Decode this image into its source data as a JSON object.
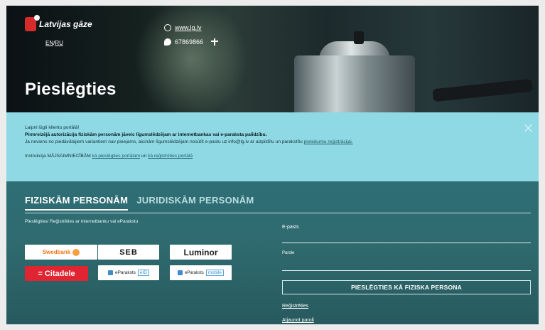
{
  "header": {
    "brand": "Latvijas gāze",
    "lang_en": "EN",
    "lang_sep": "/",
    "lang_ru": "RU",
    "website": "www.lg.lv",
    "phone": "67869866",
    "page_title": "Pieslēgties"
  },
  "notice": {
    "line1": "Laipni lūgti klientu portālā!",
    "line2": "Pirmreizējā autorizācija fiziskām personām jāveic līgumslēdzējam ar internetbankas vai e-paraksta palīdzību.",
    "line3_text": "Ja neviens no piedāvātajiem variantiem nav pieejams, aicinām līgumslēdzējam nosūtīt e-pastu uz info@lg.lv ar aizpildītu un parakstītu",
    "line3_link": "pieteikumu reģistrācijai.",
    "line4_text": "Instrukcija MĀJSAIMNIECĪBĀM",
    "line4_link1": "kā pieslēgties portālam",
    "line4_mid": "un",
    "line4_link2": "kā reģistrēties portālā"
  },
  "tabs": [
    {
      "label": "FIZISKĀM PERSONĀM"
    },
    {
      "label": "JURIDISKĀM PERSONĀM"
    }
  ],
  "login": {
    "subtitle": "Pieslēgties/ Reģistrēties ar internetbanku vai eParakstu",
    "banks": {
      "swedbank": "Swedbank",
      "seb": "SEB",
      "luminor": "Luminor",
      "citadele": "= Citadele",
      "eparaksts": "eParaksts",
      "eid_tag": "eID",
      "mobile_tag": "mobile"
    },
    "email_label": "E-pasts",
    "password_label": "Parole",
    "submit": "PIESLĒGTIES KĀ FIZISKA PERSONA",
    "register": "Reģistrēties",
    "reset": "Atjaunot paroli"
  },
  "colors": {
    "notice_bg": "#8fd9e4",
    "panel_bg": "#2e6e75",
    "citadele": "#e02431",
    "swedbank": "#f27a1a"
  }
}
